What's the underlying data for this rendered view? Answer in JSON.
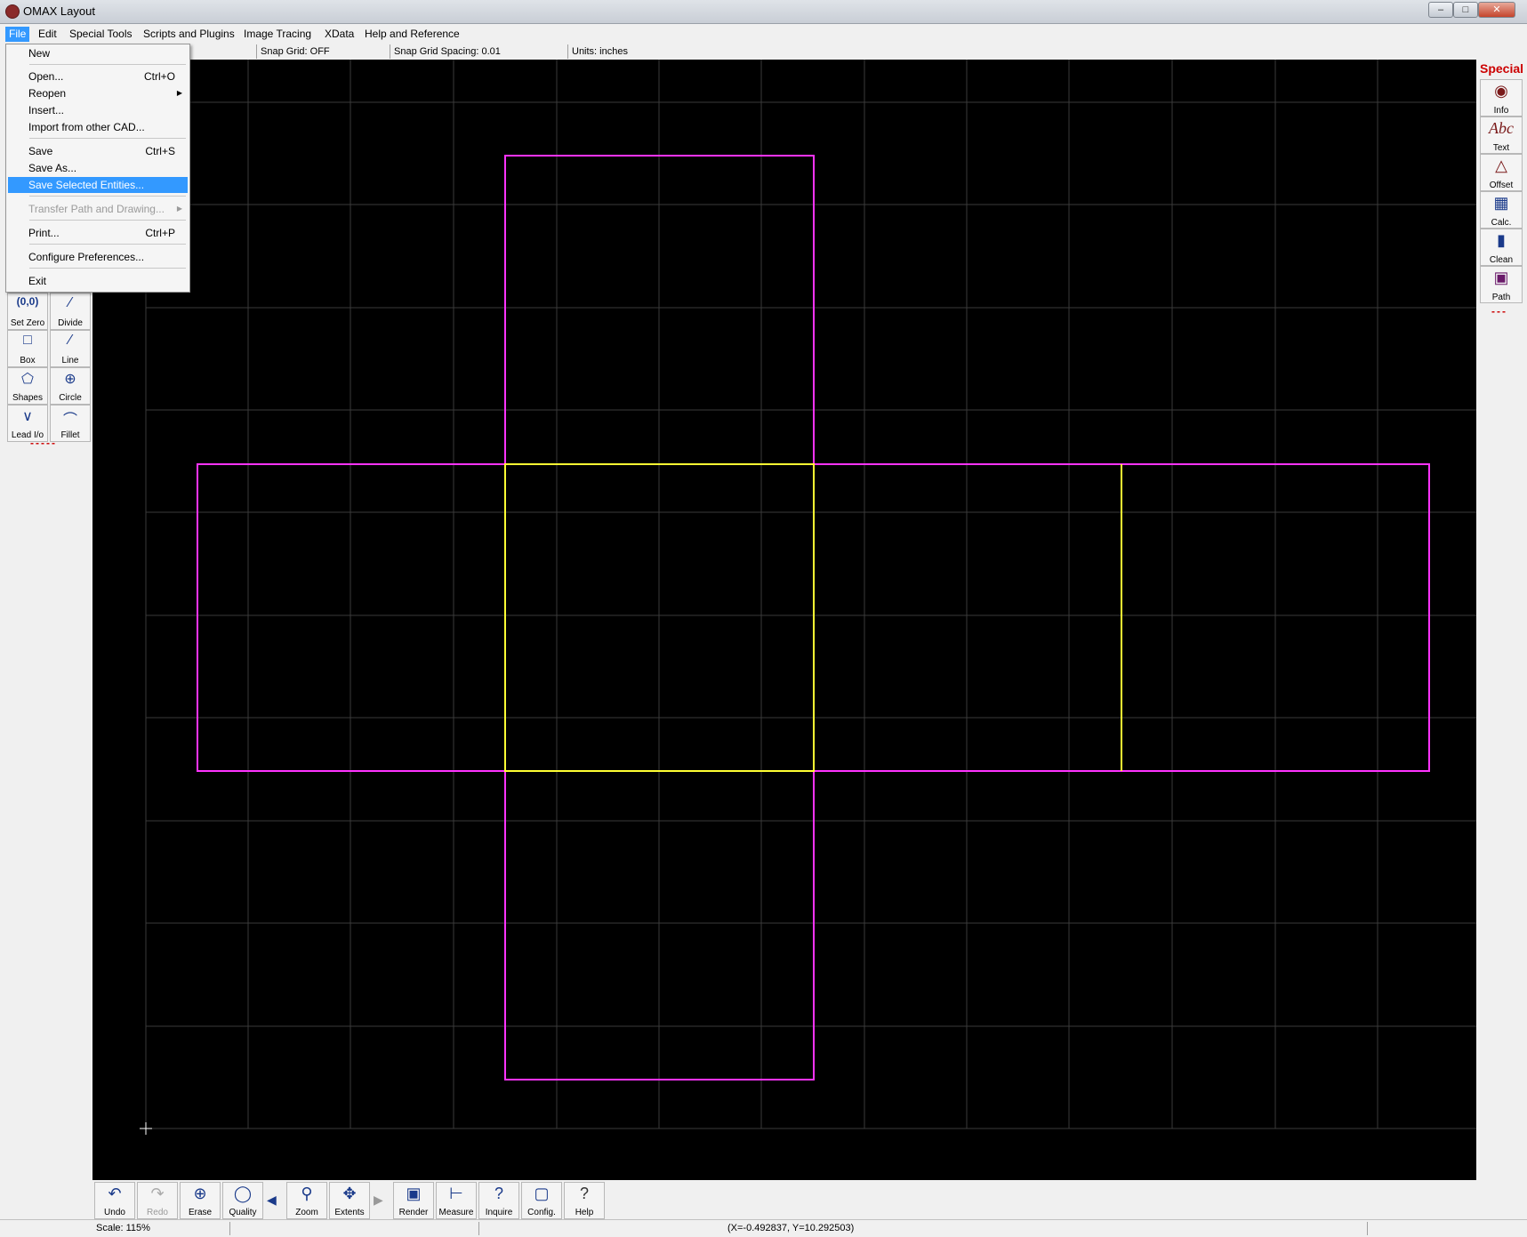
{
  "window": {
    "title": "OMAX Layout"
  },
  "menubar": {
    "items": [
      "File",
      "Edit",
      "Special Tools",
      "Scripts and Plugins",
      "Image Tracing",
      "XData",
      "Help and Reference"
    ]
  },
  "infobar": {
    "snap_grid": "Snap Grid: OFF",
    "snap_spacing": "Snap Grid Spacing: 0.01",
    "units": "Units: inches"
  },
  "file_menu": {
    "new": "New",
    "open": "Open...",
    "open_key": "Ctrl+O",
    "reopen": "Reopen",
    "insert": "Insert...",
    "import": "Import from other CAD...",
    "save": "Save",
    "save_key": "Ctrl+S",
    "save_as": "Save As...",
    "save_selected": "Save Selected Entities...",
    "transfer": "Transfer Path and Drawing...",
    "print": "Print...",
    "print_key": "Ctrl+P",
    "configure": "Configure Preferences...",
    "exit": "Exit"
  },
  "left_toolbar": {
    "set_zero": "Set Zero",
    "set_zero_glyph": "(0,0)",
    "divide": "Divide",
    "box": "Box",
    "line": "Line",
    "shapes": "Shapes",
    "circle": "Circle",
    "lead_io": "Lead I/o",
    "fillet": "Fillet",
    "dashes": "-----"
  },
  "right_toolbar": {
    "header": "Special",
    "info": "Info",
    "text": "Text",
    "text_glyph": "Abc",
    "offset": "Offset",
    "calc": "Calc.",
    "clean": "Clean",
    "path": "Path",
    "dashes": "---"
  },
  "bottom_toolbar": {
    "undo": "Undo",
    "redo": "Redo",
    "erase": "Erase",
    "quality": "Quality",
    "zoom": "Zoom",
    "extents": "Extents",
    "render": "Render",
    "measure": "Measure",
    "inquire": "Inquire",
    "config": "Config.",
    "help": "Help"
  },
  "status": {
    "scale": "Scale: 115%",
    "coords": "(X=-0.492837, Y=10.292503)"
  },
  "colors": {
    "background": "#000000",
    "grid": "#3a3a3a",
    "outline": "#ff33ff",
    "fold": "#ffff33",
    "menu_highlight": "#3399ff"
  }
}
